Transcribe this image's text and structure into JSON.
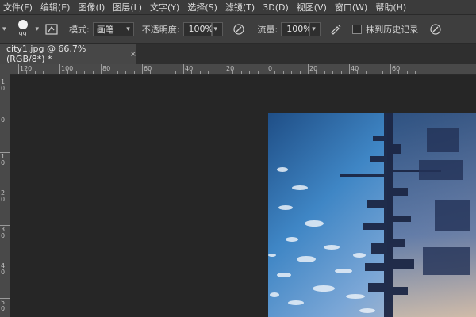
{
  "menubar": {
    "items": [
      "文件(F)",
      "编辑(E)",
      "图像(I)",
      "图层(L)",
      "文字(Y)",
      "选择(S)",
      "滤镜(T)",
      "3D(D)",
      "视图(V)",
      "窗口(W)",
      "帮助(H)"
    ]
  },
  "options": {
    "brush_size": "99",
    "mode_label": "模式:",
    "mode_value": "画笔",
    "opacity_label": "不透明度:",
    "opacity_value": "100%",
    "flow_label": "流量:",
    "flow_value": "100%",
    "history_label": "抹到历史记录"
  },
  "document_tab": {
    "title": "city1.jpg @ 66.7%(RGB/8*) *",
    "close": "×"
  },
  "ruler": {
    "top_labels": [
      "120",
      "100",
      "80",
      "60",
      "40",
      "20",
      "0",
      "20",
      "40",
      "60"
    ],
    "left_labels": [
      "1\n0",
      "0",
      "1\n0",
      "2\n0",
      "3\n0",
      "4\n0",
      "5\n0"
    ]
  },
  "colors": {
    "menubar_bg": "#3b3b3b",
    "optbar_bg": "#3e3e3e",
    "canvas_bg": "#262626"
  }
}
